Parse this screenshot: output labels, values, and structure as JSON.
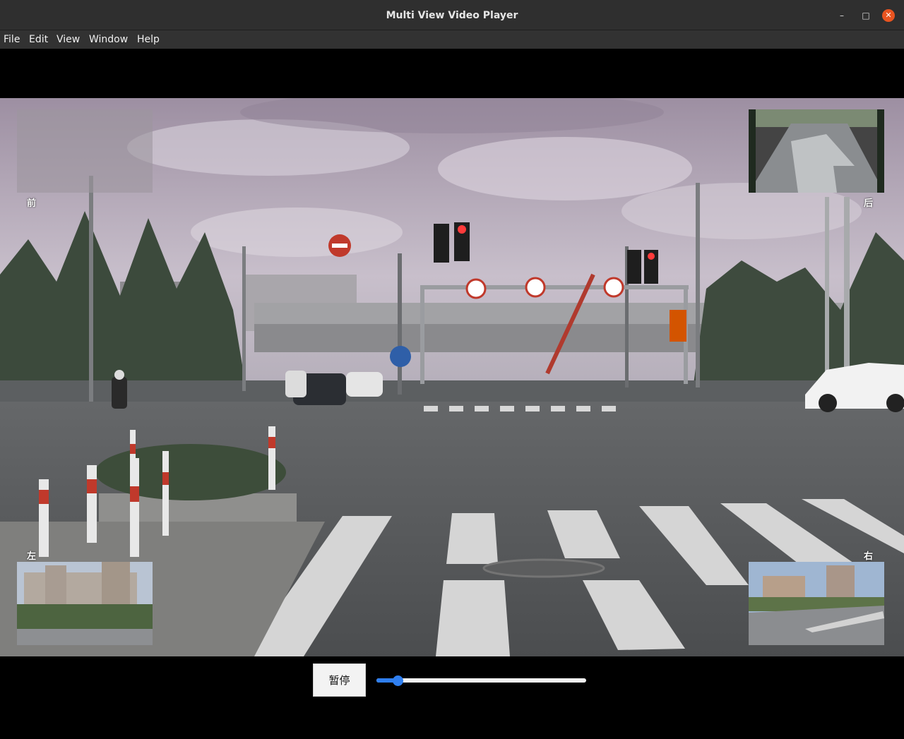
{
  "window": {
    "title": "Multi View Video Player",
    "controls": {
      "minimize": "–",
      "maximize": "□",
      "close": "✕"
    }
  },
  "menu": [
    "File",
    "Edit",
    "View",
    "Window",
    "Help"
  ],
  "views": {
    "front": "前",
    "rear": "后",
    "left": "左",
    "right": "右"
  },
  "controls": {
    "pause_label": "暂停",
    "progress": 0.1
  },
  "colors": {
    "close": "#e95420",
    "slider_accent": "#2f7ff0"
  }
}
